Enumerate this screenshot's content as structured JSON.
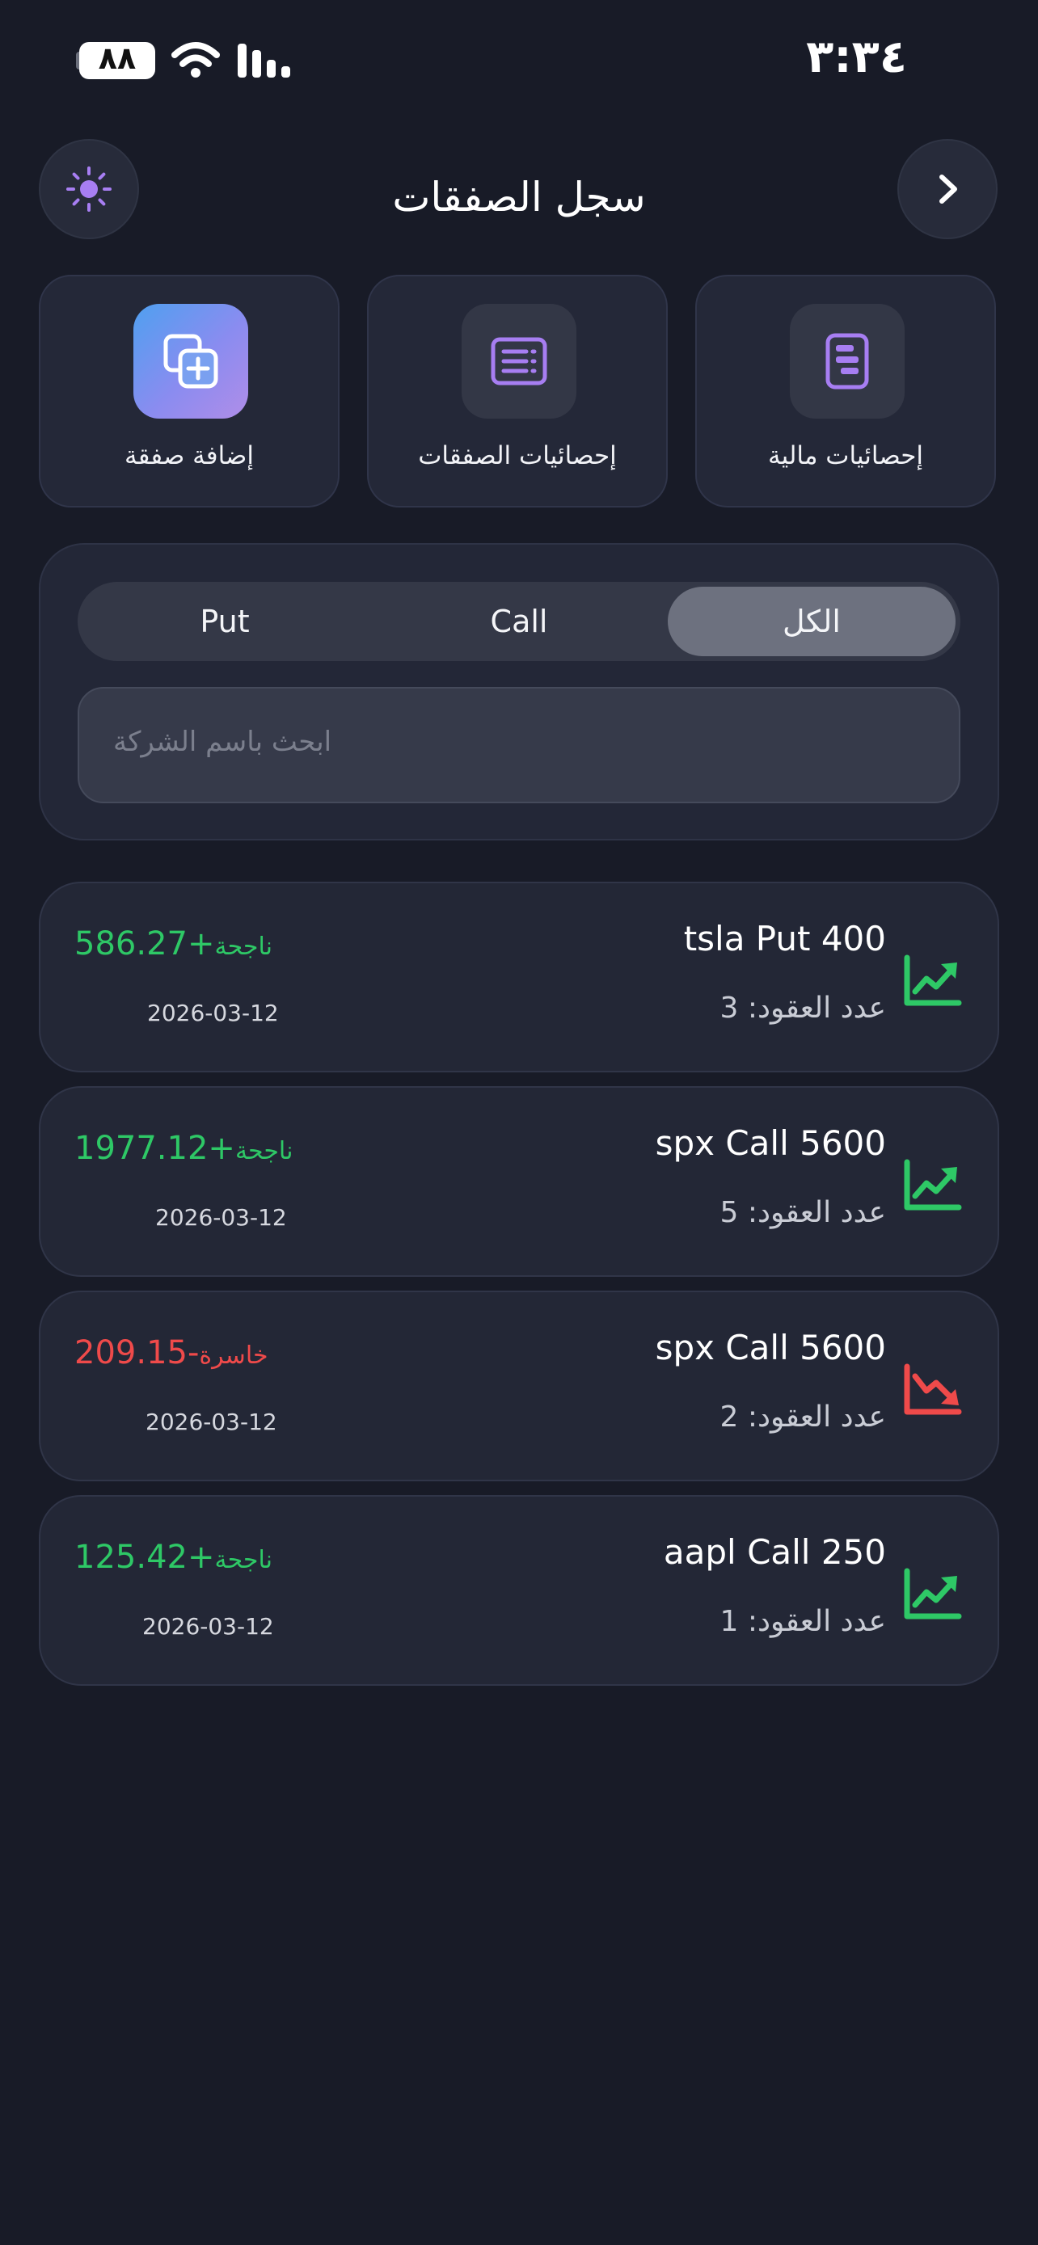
{
  "status_bar": {
    "time": "٣:٣٤",
    "battery": "٨٨"
  },
  "header": {
    "title": "سجل الصفقات",
    "theme_icon": "sun-icon",
    "nav_icon": "chevron-right-icon"
  },
  "quick_actions": [
    {
      "label": "إضافة صفقة",
      "icon": "add-copy-icon"
    },
    {
      "label": "إحصائيات الصفقات",
      "icon": "list-stats-icon"
    },
    {
      "label": "إحصائيات مالية",
      "icon": "finance-stats-icon"
    }
  ],
  "filter": {
    "tabs": [
      "الكل",
      "Call",
      "Put"
    ],
    "selected": "الكل",
    "search_placeholder": "ابحث باسم الشركة"
  },
  "trades": [
    {
      "title": "tsla Put 400",
      "contracts": "عدد العقود: 3",
      "pnl": "+586.27",
      "status": "ناجحة",
      "date": "2026-03-12",
      "trend": "up"
    },
    {
      "title": "spx Call 5600",
      "contracts": "عدد العقود: 5",
      "pnl": "+1977.12",
      "status": "ناجحة",
      "date": "2026-03-12",
      "trend": "up"
    },
    {
      "title": "spx Call 5600",
      "contracts": "عدد العقود: 2",
      "pnl": "-209.15",
      "status": "خاسرة",
      "date": "2026-03-12",
      "trend": "down"
    },
    {
      "title": "aapl Call 250",
      "contracts": "عدد العقود: 1",
      "pnl": "+125.42",
      "status": "ناجحة",
      "date": "2026-03-12",
      "trend": "up"
    }
  ],
  "colors": {
    "background": "#181b27",
    "accent": "#a77ef2",
    "profit": "#2ec866",
    "loss": "#ef4a4a"
  }
}
